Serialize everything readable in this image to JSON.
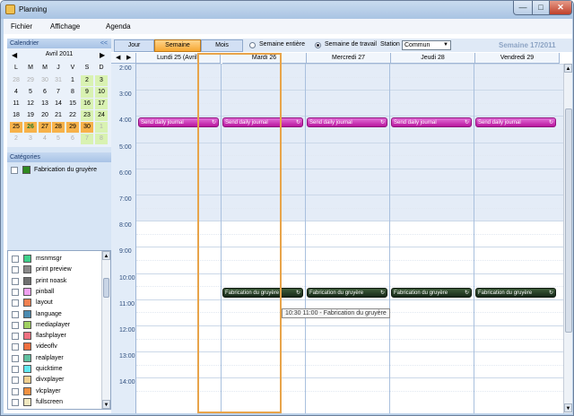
{
  "window": {
    "title": "Planning",
    "min": "—",
    "max": "□",
    "close": "✕"
  },
  "menu": [
    "Fichier",
    "Affichage",
    "Agenda"
  ],
  "sidebar": {
    "calendar_title": "Calendrier",
    "collapse": "<<",
    "month": "Avril 2011",
    "prev": "◀",
    "next": "▶",
    "dow": [
      "L",
      "M",
      "M",
      "J",
      "V",
      "S",
      "D"
    ],
    "weeks": [
      [
        "28",
        "29",
        "30",
        "31",
        "1",
        "2",
        "3"
      ],
      [
        "4",
        "5",
        "6",
        "7",
        "8",
        "9",
        "10"
      ],
      [
        "11",
        "12",
        "13",
        "14",
        "15",
        "16",
        "17"
      ],
      [
        "18",
        "19",
        "20",
        "21",
        "22",
        "23",
        "24"
      ],
      [
        "25",
        "26",
        "27",
        "28",
        "29",
        "30",
        "1"
      ],
      [
        "2",
        "3",
        "4",
        "5",
        "6",
        "7",
        "8"
      ]
    ],
    "categories_title": "Catégories",
    "category": {
      "label": "Fabrication du gruyère",
      "color": "#2f8a20"
    },
    "list": [
      {
        "label": "msnmsgr",
        "color": "#3fd08a"
      },
      {
        "label": "print preview",
        "color": "#8a8a8a"
      },
      {
        "label": "print noask",
        "color": "#707070"
      },
      {
        "label": "pinball",
        "color": "#f0a0f0"
      },
      {
        "label": "layout",
        "color": "#f08050"
      },
      {
        "label": "language",
        "color": "#4a8ab0"
      },
      {
        "label": "mediaplayer",
        "color": "#a0d060"
      },
      {
        "label": "flashplayer",
        "color": "#f07080"
      },
      {
        "label": "videoflv",
        "color": "#f07040"
      },
      {
        "label": "realplayer",
        "color": "#60c0a0"
      },
      {
        "label": "quicktime",
        "color": "#60e8f0"
      },
      {
        "label": "divxplayer",
        "color": "#f0d090"
      },
      {
        "label": "vlcplayer",
        "color": "#f09040"
      },
      {
        "label": "fullscreen",
        "color": "#f0e8c0"
      }
    ]
  },
  "toolbar": {
    "tabs": [
      "Jour",
      "Semaine",
      "Mois"
    ],
    "radio_full": "Semaine entière",
    "radio_work": "Semaine de travail",
    "station_label": "Station",
    "station_value": "Commun",
    "week_title": "Semaine 17/2011"
  },
  "header": {
    "prev": "◀",
    "next": "▶",
    "days": [
      "Lundi 25 (Avril)",
      "Mardi 26",
      "Mercredi 27",
      "Jeudi 28",
      "Vendredi 29"
    ]
  },
  "times": [
    "2:00",
    "3:00",
    "4:00",
    "5:00",
    "6:00",
    "7:00",
    "8:00",
    "9:00",
    "10:00",
    "11:00",
    "12:00",
    "13:00",
    "14:00"
  ],
  "events": {
    "morning": "Send daily journal",
    "production": "Fabrication du gruyère",
    "icon": "↻"
  },
  "tooltip": "10:30 11:00 - Fabrication du gruyère"
}
